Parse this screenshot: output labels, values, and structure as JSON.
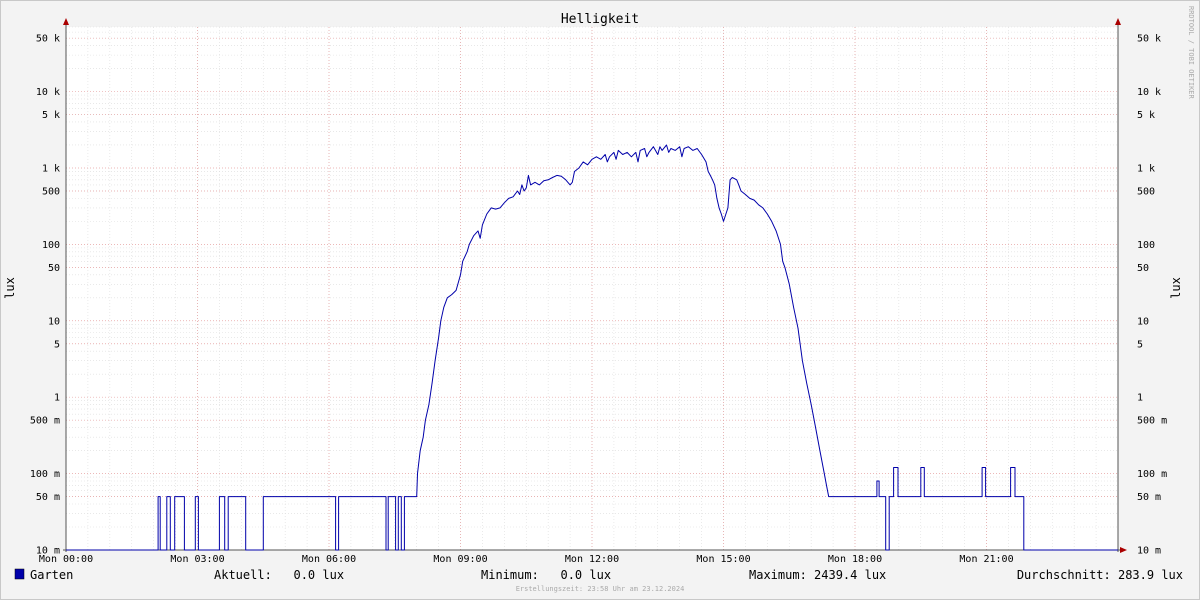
{
  "chart_data": {
    "type": "line",
    "title": "Helligkeit",
    "ylabel_left": "lux",
    "ylabel_right": "lux",
    "yscale": "log",
    "ylim": [
      0.01,
      70000
    ],
    "xlim_hours": [
      0,
      24
    ],
    "x_ticks": [
      {
        "h": 0,
        "label": "Mon 00:00"
      },
      {
        "h": 3,
        "label": "Mon 03:00"
      },
      {
        "h": 6,
        "label": "Mon 06:00"
      },
      {
        "h": 9,
        "label": "Mon 09:00"
      },
      {
        "h": 12,
        "label": "Mon 12:00"
      },
      {
        "h": 15,
        "label": "Mon 15:00"
      },
      {
        "h": 18,
        "label": "Mon 18:00"
      },
      {
        "h": 21,
        "label": "Mon 21:00"
      }
    ],
    "y_ticks": [
      {
        "v": 50000,
        "label": "50 k"
      },
      {
        "v": 10000,
        "label": "10 k"
      },
      {
        "v": 5000,
        "label": "5 k"
      },
      {
        "v": 1000,
        "label": "1 k"
      },
      {
        "v": 500,
        "label": "500"
      },
      {
        "v": 100,
        "label": "100"
      },
      {
        "v": 50,
        "label": "50"
      },
      {
        "v": 10,
        "label": "10"
      },
      {
        "v": 5,
        "label": "5"
      },
      {
        "v": 1,
        "label": "1"
      },
      {
        "v": 0.5,
        "label": "500 m"
      },
      {
        "v": 0.1,
        "label": "100 m"
      },
      {
        "v": 0.05,
        "label": "50 m"
      },
      {
        "v": 0.01,
        "label": "10 m"
      }
    ],
    "series": [
      {
        "name": "Garten",
        "color": "#0000aa",
        "points": [
          [
            0.0,
            0.01
          ],
          [
            2.1,
            0.01
          ],
          [
            2.1,
            0.05
          ],
          [
            2.15,
            0.05
          ],
          [
            2.15,
            0.01
          ],
          [
            2.3,
            0.01
          ],
          [
            2.3,
            0.05
          ],
          [
            2.38,
            0.05
          ],
          [
            2.38,
            0.01
          ],
          [
            2.48,
            0.01
          ],
          [
            2.48,
            0.05
          ],
          [
            2.7,
            0.05
          ],
          [
            2.7,
            0.01
          ],
          [
            2.95,
            0.01
          ],
          [
            2.95,
            0.05
          ],
          [
            3.02,
            0.05
          ],
          [
            3.02,
            0.01
          ],
          [
            3.5,
            0.01
          ],
          [
            3.5,
            0.05
          ],
          [
            3.62,
            0.05
          ],
          [
            3.62,
            0.01
          ],
          [
            3.7,
            0.01
          ],
          [
            3.7,
            0.05
          ],
          [
            4.1,
            0.05
          ],
          [
            4.1,
            0.01
          ],
          [
            4.5,
            0.01
          ],
          [
            4.5,
            0.05
          ],
          [
            6.15,
            0.05
          ],
          [
            6.15,
            0.01
          ],
          [
            6.22,
            0.01
          ],
          [
            6.22,
            0.05
          ],
          [
            7.3,
            0.05
          ],
          [
            7.3,
            0.01
          ],
          [
            7.35,
            0.01
          ],
          [
            7.35,
            0.05
          ],
          [
            7.52,
            0.05
          ],
          [
            7.52,
            0.01
          ],
          [
            7.58,
            0.01
          ],
          [
            7.58,
            0.05
          ],
          [
            7.65,
            0.05
          ],
          [
            7.65,
            0.01
          ],
          [
            7.72,
            0.01
          ],
          [
            7.72,
            0.05
          ],
          [
            8.0,
            0.05
          ],
          [
            8.02,
            0.1
          ],
          [
            8.08,
            0.2
          ],
          [
            8.15,
            0.3
          ],
          [
            8.2,
            0.5
          ],
          [
            8.28,
            0.8
          ],
          [
            8.35,
            1.5
          ],
          [
            8.42,
            3
          ],
          [
            8.5,
            6
          ],
          [
            8.55,
            10
          ],
          [
            8.62,
            15
          ],
          [
            8.7,
            20
          ],
          [
            8.8,
            22
          ],
          [
            8.9,
            25
          ],
          [
            9.0,
            40
          ],
          [
            9.05,
            60
          ],
          [
            9.15,
            80
          ],
          [
            9.2,
            100
          ],
          [
            9.3,
            130
          ],
          [
            9.4,
            150
          ],
          [
            9.45,
            120
          ],
          [
            9.5,
            180
          ],
          [
            9.6,
            250
          ],
          [
            9.7,
            300
          ],
          [
            9.8,
            290
          ],
          [
            9.9,
            300
          ],
          [
            10.0,
            350
          ],
          [
            10.1,
            400
          ],
          [
            10.2,
            420
          ],
          [
            10.3,
            500
          ],
          [
            10.35,
            450
          ],
          [
            10.4,
            600
          ],
          [
            10.45,
            500
          ],
          [
            10.5,
            550
          ],
          [
            10.55,
            800
          ],
          [
            10.6,
            600
          ],
          [
            10.7,
            650
          ],
          [
            10.8,
            600
          ],
          [
            10.9,
            680
          ],
          [
            11.0,
            700
          ],
          [
            11.1,
            750
          ],
          [
            11.2,
            800
          ],
          [
            11.3,
            780
          ],
          [
            11.4,
            700
          ],
          [
            11.5,
            600
          ],
          [
            11.55,
            650
          ],
          [
            11.6,
            900
          ],
          [
            11.7,
            1000
          ],
          [
            11.8,
            1200
          ],
          [
            11.9,
            1100
          ],
          [
            12.0,
            1300
          ],
          [
            12.1,
            1400
          ],
          [
            12.2,
            1300
          ],
          [
            12.3,
            1500
          ],
          [
            12.35,
            1200
          ],
          [
            12.4,
            1400
          ],
          [
            12.5,
            1600
          ],
          [
            12.55,
            1300
          ],
          [
            12.6,
            1700
          ],
          [
            12.7,
            1500
          ],
          [
            12.8,
            1600
          ],
          [
            12.9,
            1400
          ],
          [
            13.0,
            1600
          ],
          [
            13.05,
            1200
          ],
          [
            13.1,
            1700
          ],
          [
            13.2,
            1800
          ],
          [
            13.25,
            1400
          ],
          [
            13.3,
            1600
          ],
          [
            13.4,
            1900
          ],
          [
            13.5,
            1500
          ],
          [
            13.55,
            1900
          ],
          [
            13.6,
            1700
          ],
          [
            13.7,
            2000
          ],
          [
            13.75,
            1600
          ],
          [
            13.8,
            1800
          ],
          [
            13.9,
            1700
          ],
          [
            14.0,
            1900
          ],
          [
            14.05,
            1400
          ],
          [
            14.1,
            1800
          ],
          [
            14.2,
            1900
          ],
          [
            14.3,
            1700
          ],
          [
            14.4,
            1800
          ],
          [
            14.5,
            1500
          ],
          [
            14.6,
            1200
          ],
          [
            14.65,
            900
          ],
          [
            14.7,
            800
          ],
          [
            14.75,
            700
          ],
          [
            14.8,
            600
          ],
          [
            14.85,
            400
          ],
          [
            14.9,
            300
          ],
          [
            14.95,
            250
          ],
          [
            15.0,
            200
          ],
          [
            15.1,
            300
          ],
          [
            15.15,
            700
          ],
          [
            15.2,
            750
          ],
          [
            15.3,
            700
          ],
          [
            15.35,
            600
          ],
          [
            15.4,
            500
          ],
          [
            15.5,
            450
          ],
          [
            15.6,
            400
          ],
          [
            15.7,
            380
          ],
          [
            15.8,
            330
          ],
          [
            15.9,
            300
          ],
          [
            16.0,
            250
          ],
          [
            16.1,
            200
          ],
          [
            16.2,
            150
          ],
          [
            16.3,
            100
          ],
          [
            16.35,
            60
          ],
          [
            16.4,
            50
          ],
          [
            16.5,
            30
          ],
          [
            16.6,
            15
          ],
          [
            16.7,
            8
          ],
          [
            16.8,
            3
          ],
          [
            16.9,
            1.5
          ],
          [
            17.0,
            0.8
          ],
          [
            17.1,
            0.4
          ],
          [
            17.2,
            0.2
          ],
          [
            17.3,
            0.1
          ],
          [
            17.35,
            0.07
          ],
          [
            17.4,
            0.05
          ],
          [
            18.5,
            0.05
          ],
          [
            18.5,
            0.08
          ],
          [
            18.55,
            0.08
          ],
          [
            18.55,
            0.05
          ],
          [
            18.7,
            0.05
          ],
          [
            18.7,
            0.01
          ],
          [
            18.78,
            0.01
          ],
          [
            18.78,
            0.05
          ],
          [
            18.88,
            0.05
          ],
          [
            18.88,
            0.12
          ],
          [
            18.98,
            0.12
          ],
          [
            18.98,
            0.05
          ],
          [
            19.5,
            0.05
          ],
          [
            19.5,
            0.12
          ],
          [
            19.58,
            0.12
          ],
          [
            19.58,
            0.05
          ],
          [
            20.9,
            0.05
          ],
          [
            20.9,
            0.12
          ],
          [
            20.98,
            0.12
          ],
          [
            20.98,
            0.05
          ],
          [
            21.55,
            0.05
          ],
          [
            21.55,
            0.12
          ],
          [
            21.65,
            0.12
          ],
          [
            21.65,
            0.05
          ],
          [
            21.85,
            0.05
          ],
          [
            21.85,
            0.01
          ],
          [
            24.0,
            0.01
          ]
        ]
      }
    ],
    "legend": {
      "name": "Garten",
      "color": "#0000aa",
      "aktuell": "Aktuell:   0.0 lux",
      "minimum": "Minimum:   0.0 lux",
      "maximum": "Maximum: 2439.4 lux",
      "durchschnitt": "Durchschnitt: 283.9 lux"
    },
    "footer": "Erstellungszeit: 23:58 Uhr am 23.12.2024",
    "watermark": "RRDTOOL / TOBI OETIKER",
    "grid": true
  }
}
